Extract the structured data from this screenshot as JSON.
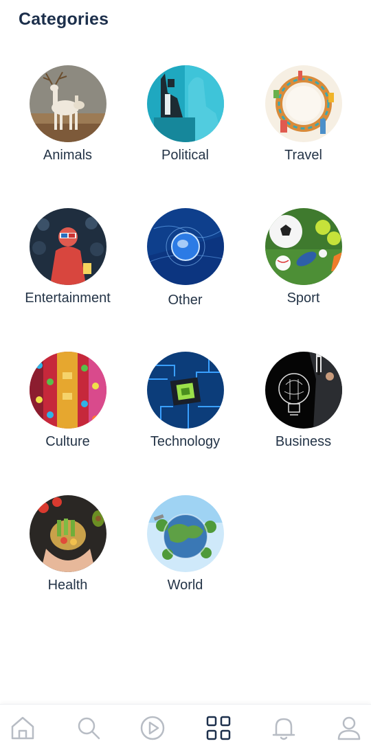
{
  "header": {
    "title": "Categories"
  },
  "categories": [
    {
      "key": "animals",
      "label": "Animals"
    },
    {
      "key": "political",
      "label": "Political"
    },
    {
      "key": "travel",
      "label": "Travel"
    },
    {
      "key": "entertainment",
      "label": "Entertainment"
    },
    {
      "key": "other",
      "label": "Other"
    },
    {
      "key": "sport",
      "label": "Sport"
    },
    {
      "key": "culture",
      "label": "Culture"
    },
    {
      "key": "technology",
      "label": "Technology"
    },
    {
      "key": "business",
      "label": "Business"
    },
    {
      "key": "health",
      "label": "Health"
    },
    {
      "key": "world",
      "label": "World"
    }
  ],
  "bottom_nav": {
    "items": [
      {
        "icon": "home-icon",
        "active": false
      },
      {
        "icon": "search-icon",
        "active": false
      },
      {
        "icon": "play-icon",
        "active": false
      },
      {
        "icon": "grid-icon",
        "active": true
      },
      {
        "icon": "bell-icon",
        "active": false
      },
      {
        "icon": "user-icon",
        "active": false
      }
    ],
    "active_color": "#1c2f4b",
    "inactive_color": "#b7bcc4"
  }
}
